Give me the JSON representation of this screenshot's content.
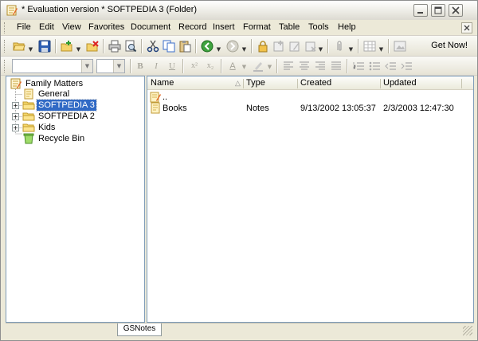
{
  "window": {
    "title": "* Evaluation version * SOFTPEDIA 3 (Folder)"
  },
  "menu": {
    "items": [
      "File",
      "Edit",
      "View",
      "Favorites",
      "Document",
      "Record",
      "Insert",
      "Format",
      "Table",
      "Tools",
      "Help"
    ],
    "get_now": "Get Now!"
  },
  "format_bar": {
    "font_value": "",
    "size_value": ""
  },
  "tree": {
    "root": "Family Matters",
    "items": [
      {
        "label": "General",
        "icon": "note-icon"
      },
      {
        "label": "SOFTPEDIA 3",
        "icon": "folder-icon",
        "selected": true
      },
      {
        "label": "SOFTPEDIA 2",
        "icon": "folder-icon"
      },
      {
        "label": "Kids",
        "icon": "folder-icon"
      },
      {
        "label": "Recycle Bin",
        "icon": "recycle-bin-icon"
      }
    ]
  },
  "list": {
    "columns": [
      "Name",
      "Type",
      "Created",
      "Updated"
    ],
    "sort_indicator": "△",
    "rows": [
      {
        "name": "..",
        "type": "",
        "created": "",
        "updated": ""
      },
      {
        "name": "Books",
        "type": "Notes",
        "created": "9/13/2002 13:05:37",
        "updated": "2/3/2003 12:47:30"
      }
    ]
  },
  "status": {
    "tab": "GSNotes"
  },
  "colors": {
    "selection": "#316ac5",
    "pane_border": "#7f9db9",
    "chrome": "#ece9d8"
  }
}
